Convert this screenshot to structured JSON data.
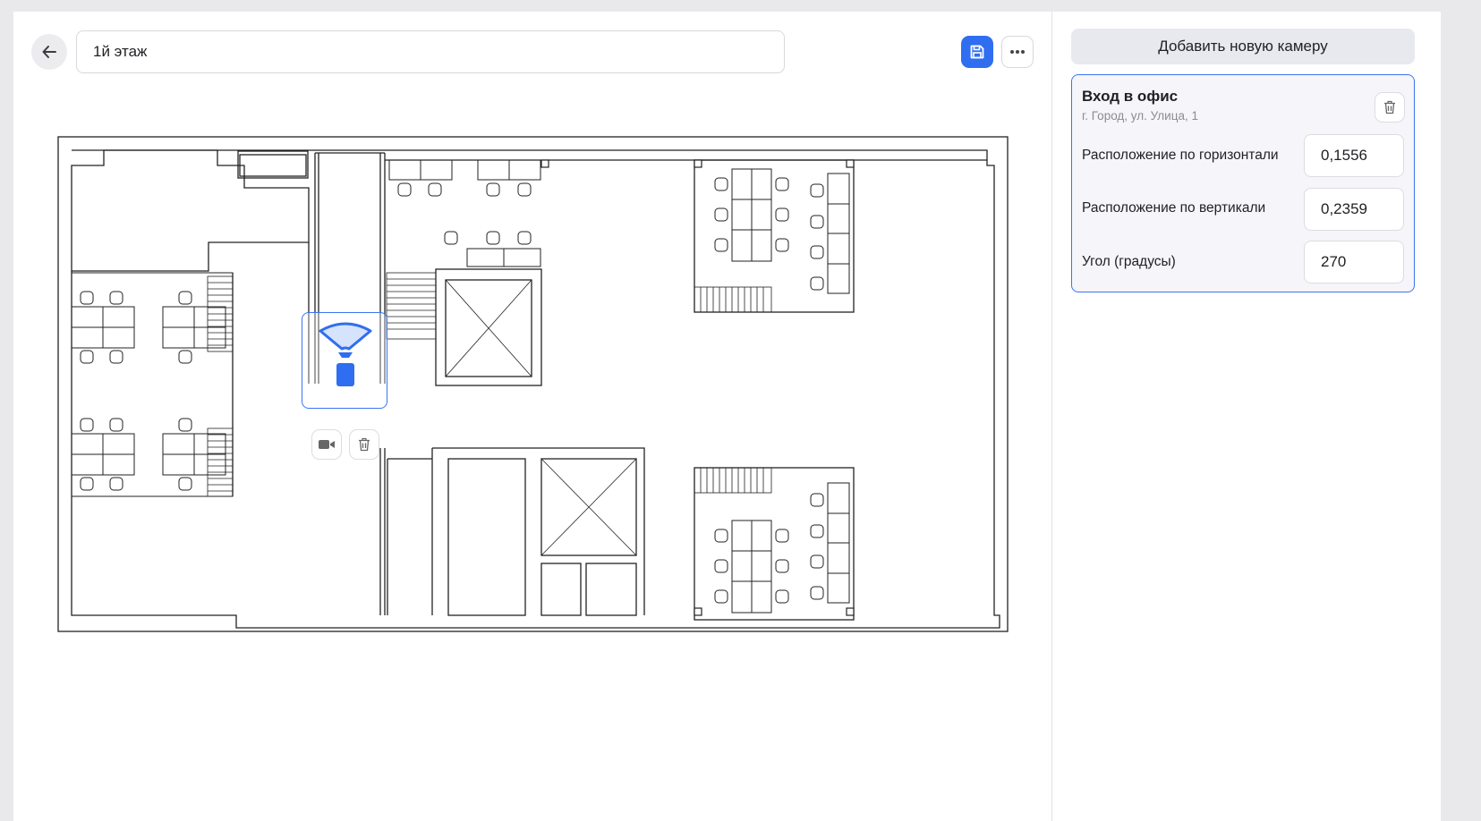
{
  "header": {
    "back_icon": "arrow-left-icon",
    "floor_title": "1й этаж",
    "save_icon": "floppy-disk-icon",
    "more_icon": "ellipsis-icon"
  },
  "floor_plan": {
    "selected_camera": {
      "icon": "camera-fov-icon",
      "actions": [
        "video-camera-icon",
        "trash-icon"
      ]
    }
  },
  "sidebar": {
    "add_camera_label": "Добавить новую камеру",
    "camera": {
      "name": "Вход в офис",
      "address": "г. Город, ул. Улица, 1",
      "delete_icon": "trash-icon",
      "fields": [
        {
          "label": "Расположение по горизонтали",
          "value": "0,1556"
        },
        {
          "label": "Расположение по вертикали",
          "value": "0,2359"
        },
        {
          "label": "Угол (градусы)",
          "value": "270"
        }
      ]
    }
  },
  "colors": {
    "accent": "#2f6ef0",
    "card_border": "#3a74f2",
    "plan_lines": "#222222"
  }
}
